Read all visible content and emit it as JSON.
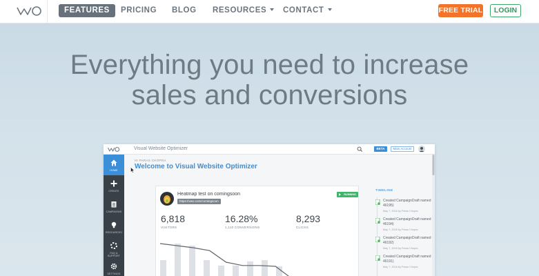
{
  "nav": {
    "logo_text": "VWO",
    "items": [
      {
        "label": "FEATURES"
      },
      {
        "label": "PRICING"
      },
      {
        "label": "BLOG"
      },
      {
        "label": "RESOURCES"
      },
      {
        "label": "CONTACT"
      }
    ],
    "free_trial": "FREE TRIAL",
    "login": "LOGIN"
  },
  "hero": {
    "line1": "Everything you need to increase",
    "line2": "sales and conversions"
  },
  "app": {
    "title": "Visual Website Optimizer",
    "beta": "BETA",
    "account": "Main Account",
    "sidebar": [
      {
        "label": "HOME"
      },
      {
        "label": "CREATE"
      },
      {
        "label": "CAMPAIGNS"
      },
      {
        "label": "RESOURCES"
      },
      {
        "label": "FAQ & SUPPORT"
      },
      {
        "label": "SETTINGS"
      }
    ],
    "greeting": "HI PARAS CHOPRA",
    "welcome": "Welcome to Visual Website Optimizer",
    "card": {
      "title": "Heatmap test on comingsoon",
      "url": "https://vwo.com/comingsoon",
      "status": "RUNNING",
      "stats": [
        {
          "value": "6,818",
          "label": "VISITORS"
        },
        {
          "value": "16.28%",
          "label": "1,110 CONVERSIONS"
        },
        {
          "value": "8,293",
          "label": "CLICKS"
        }
      ]
    },
    "chart_data": {
      "type": "bar",
      "values": [
        0.55,
        0.95,
        0.9,
        0.55,
        0.42,
        0.42,
        0.52,
        0.55,
        0.4
      ],
      "line": [
        0.95,
        0.9,
        0.85,
        0.78,
        0.5,
        0.42,
        0.42,
        0.4,
        0.1,
        0.0
      ]
    },
    "timeline": {
      "title": "TIMELINE",
      "items": [
        {
          "text": "Created CampaignDraft named (ID: 46195)",
          "meta": "May 7, 2016 by Paras Chopra"
        },
        {
          "text": "Created CampaignDraft named (ID: 46194)",
          "meta": "May 7, 2016 by Paras Chopra"
        },
        {
          "text": "Created CampaignDraft named (ID: 46192)",
          "meta": "May 7, 2016 by Paras Chopra"
        },
        {
          "text": "Created CampaignDraft named (ID: 46191)",
          "meta": "May 7, 2016 by Paras Chopra"
        }
      ]
    }
  },
  "colors": {
    "accent_blue": "#3b8fd9",
    "trial_orange": "#f1742a",
    "login_green": "#3fa66a",
    "sidebar_dark": "#3a4047"
  }
}
